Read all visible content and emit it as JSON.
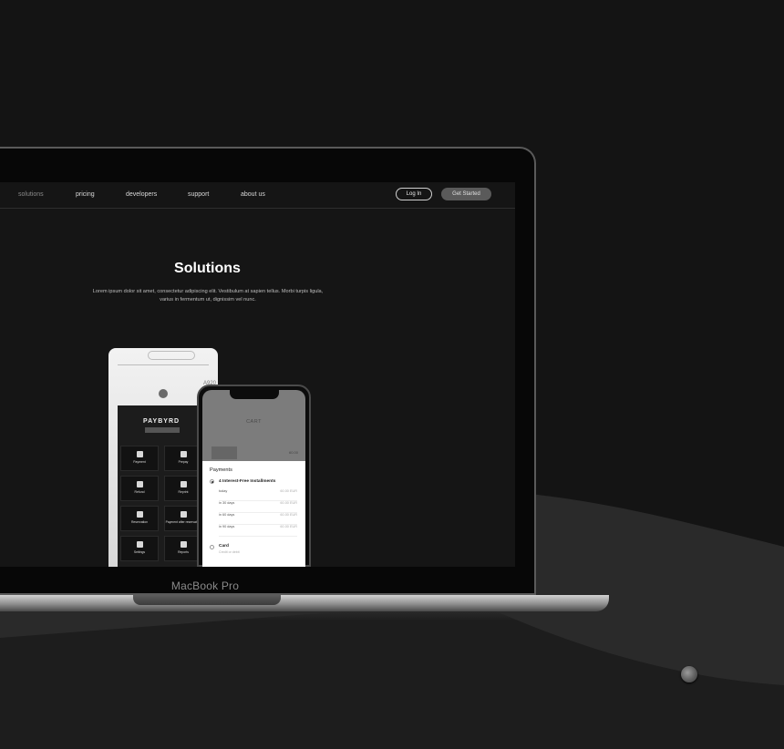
{
  "nav": {
    "items": [
      "solutions",
      "pricing",
      "developers",
      "support",
      "about us"
    ],
    "login": "Log In",
    "get_started": "Get Started"
  },
  "hero": {
    "title": "Solutions",
    "subtitle": "Lorem ipsum dolor sit amet, consectetur adipiscing elit. Vestibulum at sapien tellus. Morbi turpis ligula, varius in fermentum ut, dignissim vel nunc."
  },
  "terminal": {
    "brand": "A920",
    "logo": "PAYBYRD",
    "tiles": [
      "Payment",
      "Prepay",
      "Refund",
      "Reprint",
      "Reservation",
      "Payment after reservation",
      "Settings",
      "Reports"
    ]
  },
  "phone": {
    "cart_title": "CART",
    "cart_price": "60.00",
    "payments_title": "Payments",
    "installments_label": "4 Interest-Free Installments",
    "installments": [
      {
        "when": "today",
        "amount": "60.00 EUR"
      },
      {
        "when": "in 30 days",
        "amount": "60.00 EUR"
      },
      {
        "when": "in 60 days",
        "amount": "60.00 EUR"
      },
      {
        "when": "in 90 days",
        "amount": "60.00 EUR"
      }
    ],
    "card_label": "Card",
    "card_sub": "Credit or debit"
  },
  "laptop": {
    "model": "MacBook Pro"
  },
  "colors": {
    "background": "#141414",
    "screen": "#151515",
    "accent_button": "#5a5a5a"
  }
}
